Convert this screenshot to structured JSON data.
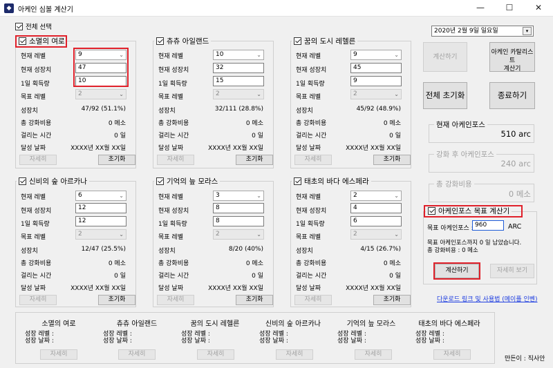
{
  "window": {
    "title": "아케인 심볼 계산기",
    "minimize": "—",
    "maximize": "☐",
    "close": "✕"
  },
  "select_all": "전체 선택",
  "labels": {
    "current_level": "현재 레벨",
    "current_growth": "현재 성장치",
    "daily_gain": "1일 획득량",
    "target_level": "목표 레벨",
    "growth": "성장치",
    "total_cost": "총 강화비용",
    "time_taken": "걸리는 시간",
    "achieve_date": "달성 날짜",
    "details_btn": "자세히",
    "reset_btn": "초기화"
  },
  "symbols": [
    {
      "name": "소멸의 여로",
      "level": "9",
      "growth_input": "47",
      "daily": "10",
      "target": "2",
      "growth": "47/92 (51.1%)",
      "cost": "0 메소",
      "time": "0 일",
      "date": "XXXX년 XX월 XX일"
    },
    {
      "name": "츄츄 아일랜드",
      "level": "10",
      "growth_input": "32",
      "daily": "15",
      "target": "2",
      "growth": "32/111 (28.8%)",
      "cost": "0 메소",
      "time": "0 일",
      "date": "XXXX년 XX월 XX일"
    },
    {
      "name": "꿈의 도시 레헬른",
      "level": "9",
      "growth_input": "45",
      "daily": "9",
      "target": "2",
      "growth": "45/92 (48.9%)",
      "cost": "0 메소",
      "time": "0 일",
      "date": "XXXX년 XX월 XX일"
    },
    {
      "name": "신비의 숲 아르카나",
      "level": "6",
      "growth_input": "12",
      "daily": "12",
      "target": "2",
      "growth": "12/47 (25.5%)",
      "cost": "0 메소",
      "time": "0 일",
      "date": "XXXX년 XX월 XX일"
    },
    {
      "name": "기억의 늪 모라스",
      "level": "3",
      "growth_input": "8",
      "daily": "8",
      "target": "2",
      "growth": "8/20 (40%)",
      "cost": "0 메소",
      "time": "0 일",
      "date": "XXXX년 XX월 XX일"
    },
    {
      "name": "태초의 바다 에스페라",
      "level": "2",
      "growth_input": "4",
      "daily": "6",
      "target": "2",
      "growth": "4/15 (26.7%)",
      "cost": "0 메소",
      "time": "0 일",
      "date": "XXXX년 XX월 XX일"
    }
  ],
  "right_panel": {
    "date": "2020년  2월  9일 일요일",
    "calc_btn": "계산하기",
    "catalyst_btn": "아케인 카탈리스트\n계산기",
    "reset_all_btn": "전체 초기화",
    "exit_btn": "종료하기",
    "current_af_label": "현재 아케인포스",
    "current_af_value": "510 arc",
    "after_af_label": "강화 후 아케인포스",
    "after_af_value": "240 arc",
    "total_cost_label": "총 강화비용",
    "total_cost_value": "0 메소",
    "target_title": "아케인포스 목표 계산기",
    "target_input_label": "목표 아케인포스 :",
    "target_input_value": "960",
    "target_unit": "ARC",
    "result_line1": "목표 아케인포스까지 0 일 남았습니다.",
    "result_line2": "총 강화비용 : 0 메소",
    "target_calc_btn": "계산하기",
    "target_detail_btn": "자세히 보기",
    "download_link": "다운로드 링크 및 사용법 (메이플 인벤)"
  },
  "summary": {
    "growth_level": "성장 레벨 :",
    "growth_date": "성장 날짜 :",
    "details_btn": "자세히"
  },
  "creator": "만든이 : 직사안"
}
